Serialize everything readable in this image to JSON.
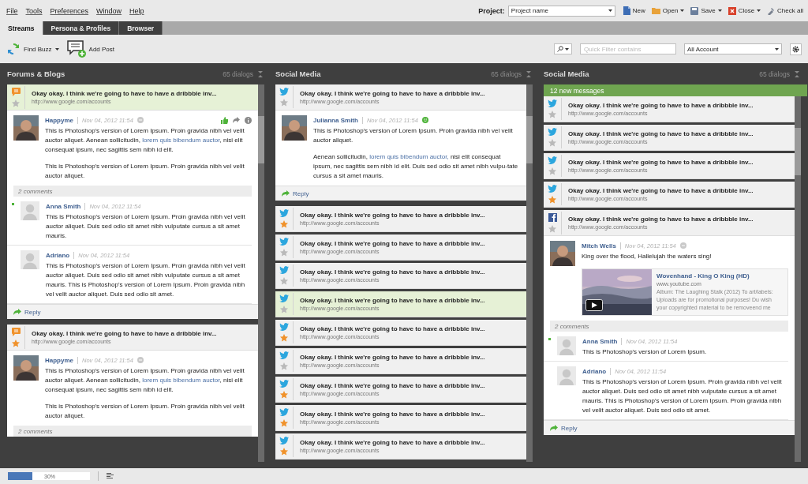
{
  "menu": [
    {
      "label": "File"
    },
    {
      "label": "Tools"
    },
    {
      "label": "Preferences"
    },
    {
      "label": "Window"
    },
    {
      "label": "Help"
    }
  ],
  "project": {
    "label": "Project:",
    "value": "Project name"
  },
  "actions": [
    {
      "label": "New",
      "kind": "doc",
      "dropdown": false
    },
    {
      "label": "Open",
      "kind": "folder",
      "dropdown": true
    },
    {
      "label": "Save",
      "kind": "disk",
      "dropdown": true
    },
    {
      "label": "Close",
      "kind": "close",
      "dropdown": true
    },
    {
      "label": "Check all",
      "kind": "tool",
      "dropdown": false
    }
  ],
  "tabs": [
    {
      "label": "Streams",
      "selected": true
    },
    {
      "label": "Persona & Profiles",
      "selected": false
    },
    {
      "label": "Browser",
      "selected": false
    }
  ],
  "toolbar": {
    "find_buzz": "Find Buzz",
    "add_post": "Add Post",
    "filter_placeholder": "Quick Filter contains",
    "account": "All Account"
  },
  "columns": [
    {
      "title": "Forums & Blogs",
      "count": "65 dialogs",
      "cards": [
        {
          "kind": "blog",
          "starred": false,
          "highlighted": true,
          "title": "Okay okay. I think we're going to have to have a dribbble inv...",
          "url": "http://www.google.com/accounts",
          "post": {
            "author": "Happyme",
            "time": "Nov 04, 2012 11:54",
            "online": false,
            "actions": true,
            "paragraphs": [
              [
                {
                  "kind": "text",
                  "text": "This is Photoshop's version of Lorem Ipsum. Proin gravida nibh vel velit auctor aliquet. Aenean sollicitudin, "
                },
                {
                  "kind": "link",
                  "text": "lorem quis bibendum auctor"
                },
                {
                  "kind": "text",
                  "text": ", nisi elit consequat ipsum, nec sagittis sem nibh id elit."
                }
              ],
              [
                {
                  "kind": "text",
                  "text": "This is Photoshop's version of Lorem Ipsum. Proin gravida nibh vel velit auctor aliquet."
                }
              ]
            ],
            "comments_label": "2 comments",
            "comments": [
              {
                "author": "Anna Smith",
                "time": "Nov 04, 2012 11:54",
                "new": true,
                "text": "This is Photoshop's version of Lorem Ipsum. Proin gravida nibh vel velit auctor aliquet. Duis sed odio sit amet nibh vulputate cursus a sit amet mauris."
              },
              {
                "author": "Adriano",
                "time": "Nov 04, 2012 11:54",
                "new": false,
                "text": "This is Photoshop's version of Lorem Ipsum. Proin gravida nibh vel velit auctor aliquet. Duis sed odio sit amet nibh vulputate cursus a sit amet mauris. This is Photoshop's version of Lorem Ipsum. Proin gravida nibh vel velit auctor aliquet. Duis sed odio sit amet."
              }
            ],
            "reply": "Reply"
          }
        },
        {
          "kind": "blog",
          "starred": true,
          "highlighted": false,
          "title": "Okay okay. I think we're going to have to have a dribbble inv...",
          "url": "http://www.google.com/accounts",
          "post": {
            "author": "Happyme",
            "time": "Nov 04, 2012 11:54",
            "online": false,
            "actions": false,
            "paragraphs": [
              [
                {
                  "kind": "text",
                  "text": "This is Photoshop's version of Lorem Ipsum. Proin gravida nibh vel velit auctor aliquet. Aenean sollicitudin, "
                },
                {
                  "kind": "link",
                  "text": "lorem quis bibendum auctor"
                },
                {
                  "kind": "text",
                  "text": ", nisi elit consequat ipsum, nec sagittis sem nibh id elit."
                }
              ],
              [
                {
                  "kind": "text",
                  "text": "This is Photoshop's version of Lorem Ipsum. Proin gravida nibh vel velit auctor aliquet."
                }
              ]
            ],
            "comments_label": "2 comments"
          }
        }
      ]
    },
    {
      "title": "Social Media",
      "count": "65 dialogs",
      "cards": [
        {
          "kind": "twitter",
          "starred": false,
          "highlighted": false,
          "title": "Okay okay. I think we're going to have to have a dribbble inv...",
          "url": "http://www.google.com/accounts",
          "post": {
            "author": "Julianna Smith",
            "time": "Nov 04, 2012 11:54",
            "online": true,
            "actions": false,
            "paragraphs": [
              [
                {
                  "kind": "text",
                  "text": "This is Photoshop's version of Lorem Ipsum. Proin gravida nibh vel velit auctor aliquet."
                }
              ],
              [
                {
                  "kind": "text",
                  "text": "Aenean sollicitudin, "
                },
                {
                  "kind": "link",
                  "text": "lorem quis bibendum auctor,"
                },
                {
                  "kind": "text",
                  "text": " nisi elit consequat ipsum, nec sagittis sem nibh id elit. Duis sed odio sit amet nibh vulpu-tate cursus a sit amet mauris."
                }
              ]
            ],
            "reply": "Reply"
          }
        },
        {
          "kind": "twitter",
          "starred": true,
          "highlighted": false,
          "title": "Okay okay. I think we're going to have to have a dribbble inv...",
          "url": "http://www.google.com/accounts"
        },
        {
          "kind": "twitter",
          "starred": false,
          "highlighted": false,
          "title": "Okay okay. I think we're going to have to have a dribbble inv...",
          "url": "http://www.google.com/accounts"
        },
        {
          "kind": "twitter",
          "starred": false,
          "highlighted": false,
          "title": "Okay okay. I think we're going to have to have a dribbble inv...",
          "url": "http://www.google.com/accounts"
        },
        {
          "kind": "twitter",
          "starred": false,
          "highlighted": true,
          "title": "Okay okay. I think we're going to have to have a dribbble inv...",
          "url": "http://www.google.com/accounts"
        },
        {
          "kind": "twitter",
          "starred": true,
          "highlighted": false,
          "title": "Okay okay. I think we're going to have to have a dribbble inv...",
          "url": "http://www.google.com/accounts"
        },
        {
          "kind": "twitter",
          "starred": false,
          "highlighted": false,
          "title": "Okay okay. I think we're going to have to have a dribbble inv...",
          "url": "http://www.google.com/accounts"
        },
        {
          "kind": "twitter",
          "starred": true,
          "highlighted": false,
          "title": "Okay okay. I think we're going to have to have a dribbble inv...",
          "url": "http://www.google.com/accounts"
        },
        {
          "kind": "twitter",
          "starred": true,
          "highlighted": false,
          "title": "Okay okay. I think we're going to have to have a dribbble inv...",
          "url": "http://www.google.com/accounts"
        },
        {
          "kind": "twitter",
          "starred": true,
          "highlighted": false,
          "title": "Okay okay. I think we're going to have to have a dribbble inv...",
          "url": "http://www.google.com/accounts"
        }
      ]
    },
    {
      "title": "Social Media",
      "count": "65 dialogs",
      "banner": "12 new messages",
      "cards": [
        {
          "kind": "twitter",
          "starred": false,
          "highlighted": false,
          "title": "Okay okay. I think we're going to have to have a dribbble inv...",
          "url": "http://www.google.com/accounts"
        },
        {
          "kind": "twitter",
          "starred": false,
          "highlighted": false,
          "title": "Okay okay. I think we're going to have to have a dribbble inv...",
          "url": "http://www.google.com/accounts"
        },
        {
          "kind": "twitter",
          "starred": false,
          "highlighted": false,
          "title": "Okay okay. I think we're going to have to have a dribbble inv...",
          "url": "http://www.google.com/accounts"
        },
        {
          "kind": "twitter",
          "starred": true,
          "highlighted": false,
          "title": "Okay okay. I think we're going to have to have a dribbble inv...",
          "url": "http://www.google.com/accounts"
        },
        {
          "kind": "facebook",
          "starred": false,
          "highlighted": false,
          "title": "Okay okay. I think we're going to have to have a dribbble inv...",
          "url": "http://www.google.com/accounts",
          "post": {
            "author": "Mitch Wells",
            "time": "Nov 04, 2012 11:54",
            "online": false,
            "actions": false,
            "paragraphs": [
              [
                {
                  "kind": "text",
                  "text": "King over the flood, Hallelujah the waters sing!"
                }
              ]
            ],
            "preview": {
              "title": "Wovenhand - King O King (HD)",
              "domain": "www.youtube.com",
              "description": "Album: The Laughing Stalk (2012) To art/labels: Uploads are for promotional purposes! Du wish your copyrighted material to be removeend me"
            },
            "comments_label": "2 comments",
            "comments": [
              {
                "author": "Anna Smith",
                "time": "Nov 04, 2012 11:54",
                "new": true,
                "text": "This is Photoshop's version of Lorem Ipsum."
              },
              {
                "author": "Adriano",
                "time": "Nov 04, 2012 11:54",
                "new": false,
                "text": "This is Photoshop's version of Lorem Ipsum. Proin gravida nibh vel velit auctor aliquet. Duis sed odio sit amet nibh vulputate cursus a sit amet mauris. This is Photoshop's version of Lorem Ipsum. Proin gravida nibh vel velit auctor aliquet. Duis sed odio sit amet."
              }
            ],
            "reply": "Reply"
          }
        }
      ]
    }
  ],
  "status": {
    "level": 0.3,
    "label": "30%"
  }
}
